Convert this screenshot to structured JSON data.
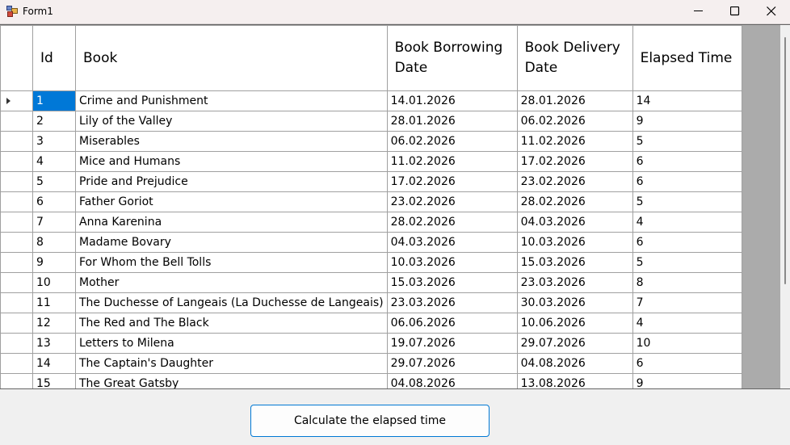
{
  "window": {
    "title": "Form1"
  },
  "grid": {
    "columns": [
      "Id",
      "Book",
      "Book Borrowing Date",
      "Book Delivery Date",
      "Elapsed Time"
    ],
    "selected_row": 0,
    "rows": [
      [
        "1",
        "Crime and Punishment",
        "14.01.2026",
        "28.01.2026",
        "14"
      ],
      [
        "2",
        "Lily of the Valley",
        "28.01.2026",
        "06.02.2026",
        "9"
      ],
      [
        "3",
        "Miserables",
        "06.02.2026",
        "11.02.2026",
        "5"
      ],
      [
        "4",
        "Mice and Humans",
        "11.02.2026",
        "17.02.2026",
        "6"
      ],
      [
        "5",
        "Pride and Prejudice",
        "17.02.2026",
        "23.02.2026",
        "6"
      ],
      [
        "6",
        "Father Goriot",
        "23.02.2026",
        "28.02.2026",
        "5"
      ],
      [
        "7",
        "Anna Karenina",
        "28.02.2026",
        "04.03.2026",
        "4"
      ],
      [
        "8",
        "Madame Bovary",
        "04.03.2026",
        "10.03.2026",
        "6"
      ],
      [
        "9",
        "For Whom the Bell Tolls",
        "10.03.2026",
        "15.03.2026",
        "5"
      ],
      [
        "10",
        "Mother",
        "15.03.2026",
        "23.03.2026",
        "8"
      ],
      [
        "11",
        "The Duchesse of Langeais (La Duchesse de Langeais)",
        "23.03.2026",
        "30.03.2026",
        "7"
      ],
      [
        "12",
        "The Red and The Black",
        "06.06.2026",
        "10.06.2026",
        "4"
      ],
      [
        "13",
        "Letters to Milena",
        "19.07.2026",
        "29.07.2026",
        "10"
      ],
      [
        "14",
        "The Captain's Daughter",
        "29.07.2026",
        "04.08.2026",
        "6"
      ],
      [
        "15",
        "The Great Gatsby",
        "04.08.2026",
        "13.08.2026",
        "9"
      ]
    ]
  },
  "actions": {
    "calculate_label": "Calculate the elapsed time"
  },
  "colors": {
    "selection": "#0078d7",
    "grid_background": "#ababab",
    "button_border": "#0078d4"
  },
  "icons": [
    "app-icon",
    "minimize-icon",
    "maximize-icon",
    "close-icon",
    "row-pointer-icon"
  ]
}
